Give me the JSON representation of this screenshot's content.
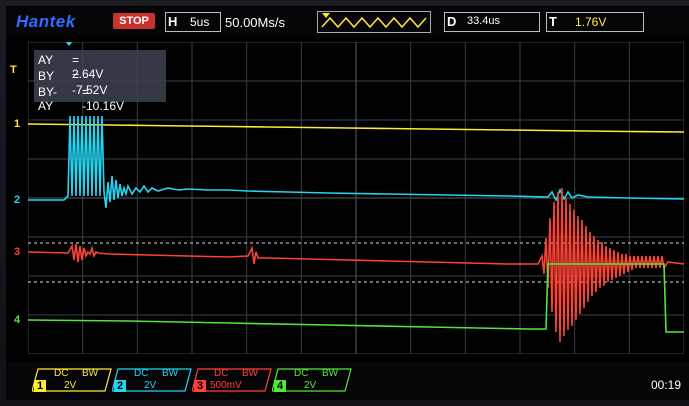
{
  "header": {
    "brand": "Hantek",
    "run_state": "STOP",
    "horizontal_label": "H",
    "timebase": "5us",
    "sample_rate": "50.00Ms/s",
    "delay_label": "D",
    "delay": "33.4us",
    "trigger_label": "T",
    "trigger_level": "1.76V"
  },
  "cursors": {
    "ay_label": "AY",
    "ay_value": "= 2.64V",
    "by_label": "BY",
    "by_value": "= -7.52V",
    "diff_label": "BY-AY",
    "diff_value": "= -10.16V"
  },
  "channels": [
    {
      "num": "1",
      "coupling": "DC",
      "bw": "BW",
      "scale": "2V",
      "color": "#ffe93b"
    },
    {
      "num": "2",
      "coupling": "DC",
      "bw": "BW",
      "scale": "2V",
      "color": "#26d4f0"
    },
    {
      "num": "3",
      "coupling": "DC",
      "bw": "BW",
      "scale": "500mV",
      "color": "#ff4236"
    },
    {
      "num": "4",
      "coupling": "DC",
      "bw": "BW",
      "scale": "2V",
      "color": "#53e63a"
    }
  ],
  "markers": {
    "ch1": "1",
    "ch2": "2",
    "ch3": "3",
    "ch4": "4",
    "trigger": "T"
  },
  "clock": "00:19"
}
